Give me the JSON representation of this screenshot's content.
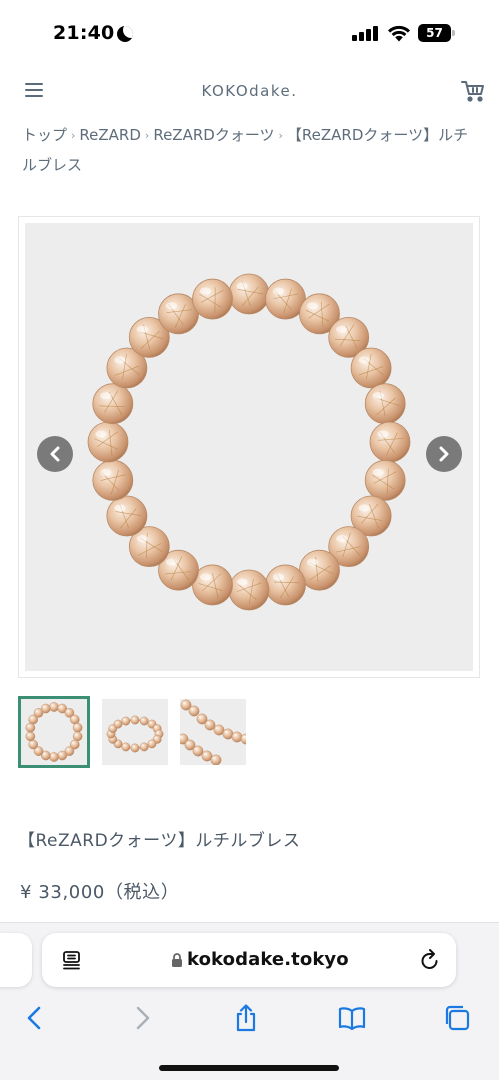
{
  "status_bar": {
    "time": "21:40",
    "battery": "57",
    "icons": [
      "moon-icon",
      "signal-icon",
      "wifi-icon",
      "battery-icon"
    ]
  },
  "header": {
    "site_title": "KOKOdake.",
    "icons": [
      "menu-icon",
      "cart-icon"
    ]
  },
  "breadcrumb": {
    "items": [
      "トップ",
      "ReZARD",
      "ReZARDクォーツ",
      "【ReZARDクォーツ】ルチルブレス"
    ]
  },
  "gallery": {
    "icons": [
      "chevron-left-icon",
      "chevron-right-icon"
    ],
    "thumbnail_count": 3,
    "active_thumbnail": 1
  },
  "product": {
    "title": "【ReZARDクォーツ】ルチルブレス",
    "price": "¥ 33,000（税込）"
  },
  "browser": {
    "url": "kokodake.tokyo",
    "icons": [
      "reader-icon",
      "lock-icon",
      "reload-icon",
      "back-icon",
      "forward-icon",
      "share-icon",
      "bookmarks-icon",
      "tabs-icon"
    ]
  },
  "colors": {
    "text": "#4b5866",
    "active_thumb_border": "#3b8f74",
    "image_bg": "#ededed",
    "arrow_bg": "#7a7a7a"
  }
}
